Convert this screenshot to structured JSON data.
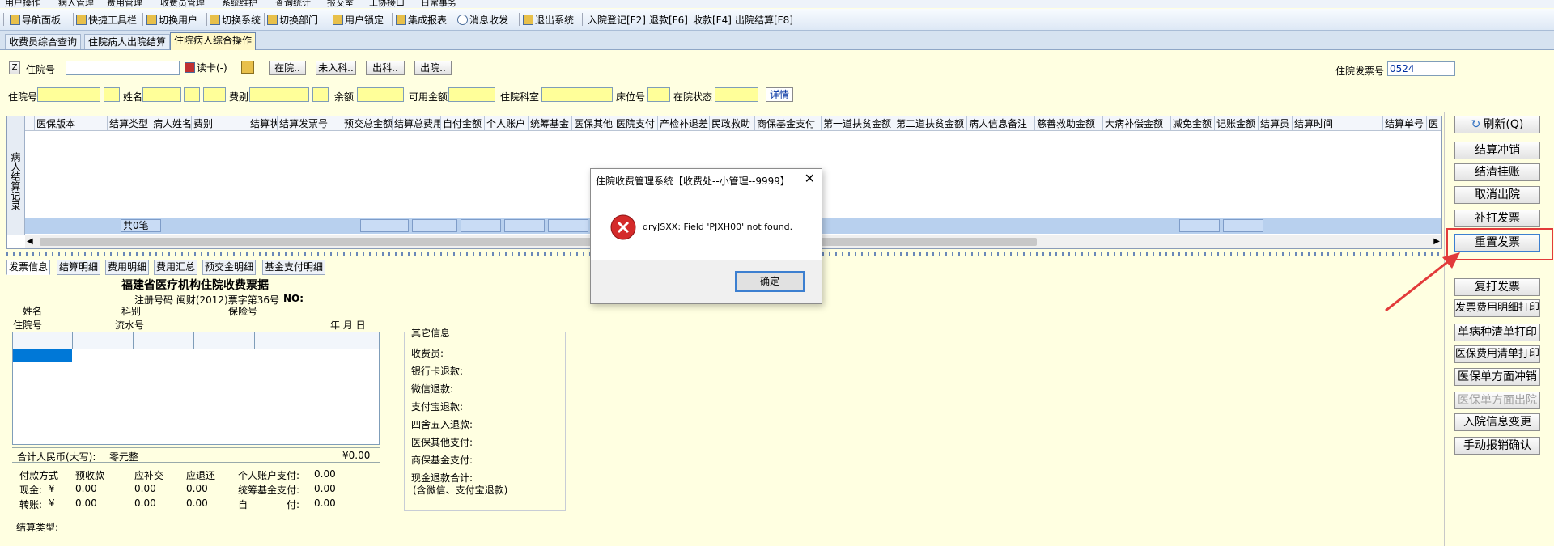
{
  "menubar": {
    "items": [
      "用户操作",
      "病人管理",
      "费用管理",
      "收费员管理",
      "系统维护",
      "查询统计",
      "报交室",
      "工协接口",
      "日常事务"
    ]
  },
  "toolbar": {
    "items": [
      "导航面板",
      "快捷工具栏",
      "切换用户",
      "切换系统",
      "切换部门",
      "用户锁定",
      "集成报表",
      "消息收发",
      "退出系统"
    ],
    "shortcuts": [
      "入院登记[F2]",
      "退款[F6]",
      "收款[F4]",
      "出院结算[F8]"
    ]
  },
  "tabs": [
    "收费员综合查询",
    "住院病人出院结算",
    "住院病人综合操作"
  ],
  "search": {
    "z_label": "Z",
    "inpatient_label": "住院号",
    "inpatient_value": "",
    "read_card": "读卡(-)",
    "btn_in": "在院..",
    "btn_notin": "未入科..",
    "btn_outdept": "出科..",
    "btn_discharge": "出院..",
    "invoice_label": "住院发票号",
    "invoice_value": "0524"
  },
  "info": {
    "inpatient": "住院号",
    "name": "姓名",
    "feetype": "费别",
    "balance": "余额",
    "available": "可用金额",
    "dept": "住院科室",
    "bed": "床位号",
    "status": "在院状态",
    "detail": "详情"
  },
  "grid": {
    "side_label": "病人结算记录",
    "columns": [
      "医保版本",
      "结算类型",
      "病人姓名",
      "费别",
      "结算状",
      "结算发票号",
      "预交总金额",
      "结算总费用",
      "自付金额",
      "个人账户",
      "统筹基金",
      "医保其他",
      "医院支付",
      "产检补退差",
      "民政救助",
      "商保基金支付",
      "第一道扶贫金额",
      "第二道扶贫金额",
      "病人信息备注",
      "慈善救助金额",
      "大病补偿金额",
      "减免金额",
      "记账金额",
      "结算员",
      "结算时间",
      "结算单号",
      "医"
    ],
    "summary_count": "共0笔"
  },
  "bottom_tabs": [
    "发票信息",
    "结算明细",
    "费用明细",
    "费用汇总",
    "预交金明细",
    "基金支付明细"
  ],
  "receipt": {
    "title": "福建省医疗机构住院收费票据",
    "reg": "注册号码 闽财(2012)票字第36号",
    "no": "NO:",
    "name": "姓名",
    "dept": "科别",
    "ins_no": "保险号",
    "inpatient": "住院号",
    "serial": "流水号",
    "date": "年  月  日",
    "total_label": "合计人民币(大写):",
    "total_cn": "零元整",
    "total_amount": "¥0.00",
    "pay_heads": [
      "付款方式",
      "预收款",
      "应补交",
      "应退还",
      "个人账户支付:",
      "0.00"
    ],
    "cash_row": [
      "现金:",
      "¥",
      "0.00",
      "0.00",
      "0.00",
      "统筹基金支付:",
      "0.00"
    ],
    "transfer_row": [
      "转账:",
      "¥",
      "0.00",
      "0.00",
      "0.00",
      "自",
      "付:",
      "0.00"
    ],
    "settle_type": "结算类型:"
  },
  "other": {
    "title": "其它信息",
    "items": [
      "收费员:",
      "银行卡退款:",
      "微信退款:",
      "支付宝退款:",
      "四舍五入退款:",
      "医保其他支付:",
      "商保基金支付:",
      "现金退款合计:",
      "(含微信、支付宝退款)"
    ]
  },
  "side_buttons": {
    "refresh": "刷新(Q)",
    "b1": "结算冲销",
    "b2": "结清挂账",
    "b3": "取消出院",
    "b4": "补打发票",
    "b5": "重置发票",
    "b6": "复打发票",
    "b7": "发票费用明细打印",
    "b8": "单病种清单打印",
    "b9": "医保费用清单打印",
    "b10": "医保单方面冲销",
    "b11": "医保单方面出院",
    "b12": "入院信息变更",
    "b13": "手动报销确认"
  },
  "dialog": {
    "title": "住院收费管理系统【收费处--小管理--9999】",
    "message": "qryJSXX: Field 'PJXH00' not found.",
    "ok": "确定"
  },
  "colors": {
    "highlight": "#E23A3A",
    "accent": "#0078D7"
  }
}
